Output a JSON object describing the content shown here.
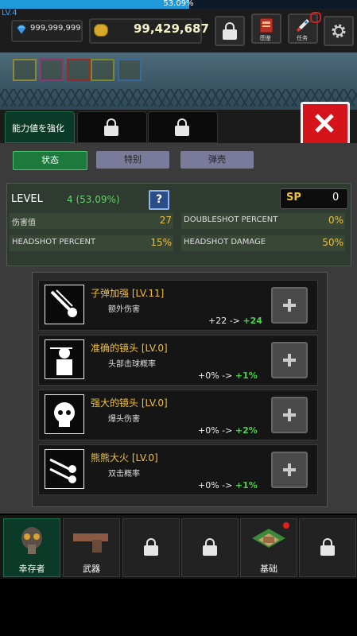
{
  "xp": {
    "percent_text": "53.09%",
    "fraction": 0.5309,
    "level_text": "LV.4"
  },
  "currency": {
    "gems": "999,999,999",
    "gold": "99,429,687"
  },
  "top_buttons": {
    "book_label": "图鉴",
    "quest_label": "任务"
  },
  "tabs": {
    "first_label": "能力値を強化"
  },
  "subtabs": [
    "状态",
    "特别",
    "弹壳"
  ],
  "stats": {
    "level_label": "LEVEL",
    "level_value": "4 (53.09%)",
    "help": "?",
    "sp_label": "SP",
    "sp_value": "0",
    "rows": [
      {
        "label": "伤害值",
        "value": "27"
      },
      {
        "label": "DOUBLESHOT PERCENT",
        "value": "0%"
      },
      {
        "label": "HEADSHOT PERCENT",
        "value": "15%"
      },
      {
        "label": "HEADSHOT DAMAGE",
        "value": "50%"
      }
    ]
  },
  "skills": [
    {
      "name": "子弹加强 [LV.11]",
      "desc": "额外伤害",
      "from": "+22 ->",
      "to": "+24"
    },
    {
      "name": "准确的镜头 [LV.0]",
      "desc": "头部击球概率",
      "from": "+0% ->",
      "to": "+1%"
    },
    {
      "name": "强大的镜头 [LV.0]",
      "desc": "爆头伤害",
      "from": "+0% ->",
      "to": "+2%"
    },
    {
      "name": "熊熊大火 [LV.0]",
      "desc": "双击概率",
      "from": "+0% ->",
      "to": "+1%"
    }
  ],
  "nav": {
    "survivor_label": "幸存者",
    "weapon_label": "武器",
    "base_label": "基础"
  },
  "colors": {
    "accent_green": "#61d36a",
    "gold": "#f0c040",
    "close_red": "#d4141a",
    "xp_blue": "#1f9bdc"
  }
}
